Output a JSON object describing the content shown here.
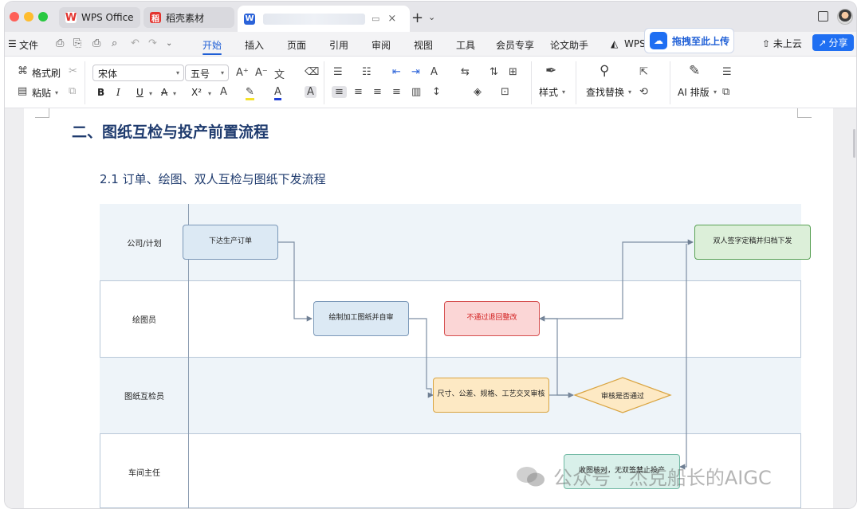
{
  "tabs": {
    "wps_label": "WPS Office",
    "daoke_label": "稻壳素材",
    "doc_close": "×",
    "new_tab": "+"
  },
  "menu": {
    "file": "文件",
    "items": [
      "开始",
      "插入",
      "页面",
      "引用",
      "审阅",
      "视图",
      "工具",
      "会员专享",
      "论文助手"
    ],
    "wps_ai": "WPS",
    "upload": "拖拽至此上传",
    "cloud": "未上云",
    "share": "分享"
  },
  "ribbon": {
    "format_painter": "格式刷",
    "paste": "粘贴",
    "font_name": "宋体",
    "font_size": "五号",
    "bold": "B",
    "italic": "I",
    "underline": "U",
    "strike": "A",
    "superscript": "X²",
    "styles": "样式",
    "find_replace": "查找替换",
    "ai_layout": "AI 排版"
  },
  "document": {
    "heading": "二、图纸互检与投产前置流程",
    "subheading": "2.1 订单、绘图、双人互检与图纸下发流程"
  },
  "diagram": {
    "lanes": [
      "公司/计划",
      "绘图员",
      "图纸互检员",
      "车间主任"
    ],
    "nodes": {
      "issue_plan": "下达生产订单",
      "draw_self_check": "绘制加工图纸并自审",
      "reject_rework": "不通过退回整改",
      "cross_check": "尺寸、公差、规格、工艺交叉审核",
      "review_pass": "审核是否通过",
      "sign_archive": "双人签字定稿并归档下发",
      "receive_check": "收图核对，无双签禁止投产"
    }
  },
  "watermark": "公众号 · 杰克船长的AIGC",
  "colors": {
    "accent": "#1f5fd6",
    "heading": "#1f3b6e",
    "node_blue": "#dce9f4",
    "node_red": "#fbd6d6",
    "node_yellow": "#fde9c4",
    "node_green": "#dcefd9"
  }
}
